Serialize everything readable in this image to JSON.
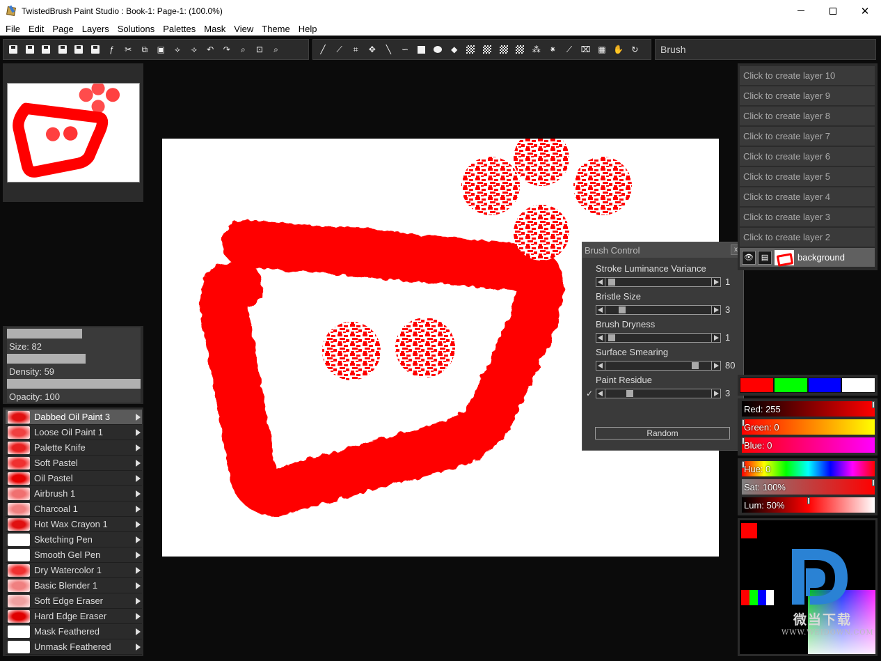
{
  "window": {
    "title": "TwistedBrush Paint Studio : Book-1: Page-1:  (100.0%)",
    "controls": {
      "minimize": "—",
      "maximize": "☐",
      "close": "✕"
    }
  },
  "menu": [
    "File",
    "Edit",
    "Page",
    "Layers",
    "Solutions",
    "Palettes",
    "Mask",
    "View",
    "Theme",
    "Help"
  ],
  "toolbar": {
    "brush_label": "Brush"
  },
  "brush_params": {
    "size": {
      "label": "Size: 82",
      "fraction": 0.56
    },
    "density": {
      "label": "Density: 59",
      "fraction": 0.59
    },
    "opacity": {
      "label": "Opacity: 100",
      "fraction": 1.0
    }
  },
  "brushes": [
    {
      "name": "Dabbed Oil Paint 3",
      "selected": true,
      "thumb": "#e01010"
    },
    {
      "name": "Loose Oil Paint 1",
      "selected": false,
      "thumb": "#f04040"
    },
    {
      "name": "Palette Knife",
      "selected": false,
      "thumb": "#e82020"
    },
    {
      "name": "Soft Pastel",
      "selected": false,
      "thumb": "#f03030"
    },
    {
      "name": "Oil Pastel",
      "selected": false,
      "thumb": "#e80000"
    },
    {
      "name": "Airbrush 1",
      "selected": false,
      "thumb": "#f07070"
    },
    {
      "name": "Charcoal 1",
      "selected": false,
      "thumb": "#f08080"
    },
    {
      "name": "Hot Wax Crayon 1",
      "selected": false,
      "thumb": "#e01010"
    },
    {
      "name": "Sketching Pen",
      "selected": false,
      "thumb": "#ffffff"
    },
    {
      "name": "Smooth Gel Pen",
      "selected": false,
      "thumb": "#ffffff"
    },
    {
      "name": "Dry Watercolor 1",
      "selected": false,
      "thumb": "#f03030"
    },
    {
      "name": "Basic Blender 1",
      "selected": false,
      "thumb": "#f08080"
    },
    {
      "name": "Soft Edge Eraser",
      "selected": false,
      "thumb": "#f0a0a0"
    },
    {
      "name": "Hard Edge Eraser",
      "selected": false,
      "thumb": "#e00000"
    },
    {
      "name": "Mask Feathered",
      "selected": false,
      "thumb": "#ffffff"
    },
    {
      "name": "Unmask Feathered",
      "selected": false,
      "thumb": "#ffffff"
    }
  ],
  "brush_control": {
    "title": "Brush Control",
    "close": "x",
    "settings": [
      {
        "label": "Stroke Luminance Variance",
        "value": "1",
        "fraction": 0.03
      },
      {
        "label": "Bristle Size",
        "value": "3",
        "fraction": 0.13
      },
      {
        "label": "Brush Dryness",
        "value": "1",
        "fraction": 0.03
      },
      {
        "label": "Surface Smearing",
        "value": "80",
        "fraction": 0.86
      },
      {
        "label": "Paint Residue",
        "value": "3",
        "fraction": 0.21
      }
    ],
    "checkmark": "✓",
    "random_button": "Random"
  },
  "layers": [
    "Click to create layer 10",
    "Click to create layer 9",
    "Click to create layer 8",
    "Click to create layer 7",
    "Click to create layer 6",
    "Click to create layer 5",
    "Click to create layer 4",
    "Click to create layer 3",
    "Click to create layer 2"
  ],
  "background_layer": {
    "name": "background",
    "eye_icon": "👁",
    "lock_icon": "▤"
  },
  "swatches": [
    "#ff0000",
    "#00ff00",
    "#0000ff",
    "#ffffff"
  ],
  "rgb": [
    {
      "label": "Red: 255",
      "fraction": 1.0,
      "gradient": "linear-gradient(to right,#000,#ff0000)"
    },
    {
      "label": "Green: 0",
      "fraction": 0.0,
      "gradient": "linear-gradient(to right,#ff0000,#ffff00)"
    },
    {
      "label": "Blue: 0",
      "fraction": 0.0,
      "gradient": "linear-gradient(to right,#ff0000,#ff00ff)"
    }
  ],
  "hsl": [
    {
      "label": "Hue: 0",
      "fraction": 0.0,
      "gradient": "linear-gradient(to right,#f00,#ff0,#0f0,#0ff,#00f,#f0f,#f00)"
    },
    {
      "label": "Sat: 100%",
      "fraction": 1.0,
      "gradient": "linear-gradient(to right,#808080,#ff0000)"
    },
    {
      "label": "Lum: 50%",
      "fraction": 0.5,
      "gradient": "linear-gradient(to right,#000,#ff0000,#fff)"
    }
  ],
  "watermark": {
    "text": "微当下载",
    "url": "WWW.WEIDOWN.COM"
  },
  "colors": {
    "paint": "#ff0000",
    "panel": "#2b2b2b",
    "selected": "#5a5a5a"
  }
}
